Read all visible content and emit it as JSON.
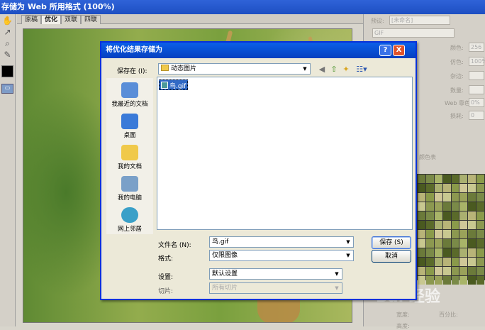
{
  "window": {
    "title": "存储为 Web 所用格式 (100%)"
  },
  "tabs": [
    "原稿",
    "优化",
    "双联",
    "四联"
  ],
  "right_panel": {
    "preset_label": "预设:",
    "preset_value": "[未命名]",
    "format_value": "GIF",
    "labels": [
      "颜色:",
      "仿色:",
      "杂边:",
      "数量:",
      "Web 靠色:",
      "损耗:"
    ],
    "values": [
      "256",
      "100%",
      "",
      "",
      "0%",
      "0"
    ],
    "color_table_title": "颜色表",
    "bottom_labels": [
      "宽度:",
      "高度:",
      "百分比:"
    ]
  },
  "watermark": "Bai 经验",
  "dialog": {
    "title": "将优化结果存储为",
    "save_in_label": "保存在 (I):",
    "save_in_value": "动态图片",
    "places": [
      {
        "label": "我最近的文档",
        "icon": "recent-documents-icon"
      },
      {
        "label": "桌面",
        "icon": "desktop-icon"
      },
      {
        "label": "我的文档",
        "icon": "my-documents-icon"
      },
      {
        "label": "我的电脑",
        "icon": "my-computer-icon"
      },
      {
        "label": "网上邻居",
        "icon": "network-places-icon"
      }
    ],
    "files": [
      {
        "name": "鸟.gif"
      }
    ],
    "filename_label": "文件名 (N):",
    "filename_value": "鸟.gif",
    "format_label": "格式:",
    "format_value": "仅限图像",
    "settings_label": "设置:",
    "settings_value": "默认设置",
    "slices_label": "切片:",
    "slices_value": "所有切片",
    "save_button": "保存 (S)",
    "cancel_button": "取消",
    "help_button": "?",
    "close_button": "X"
  }
}
